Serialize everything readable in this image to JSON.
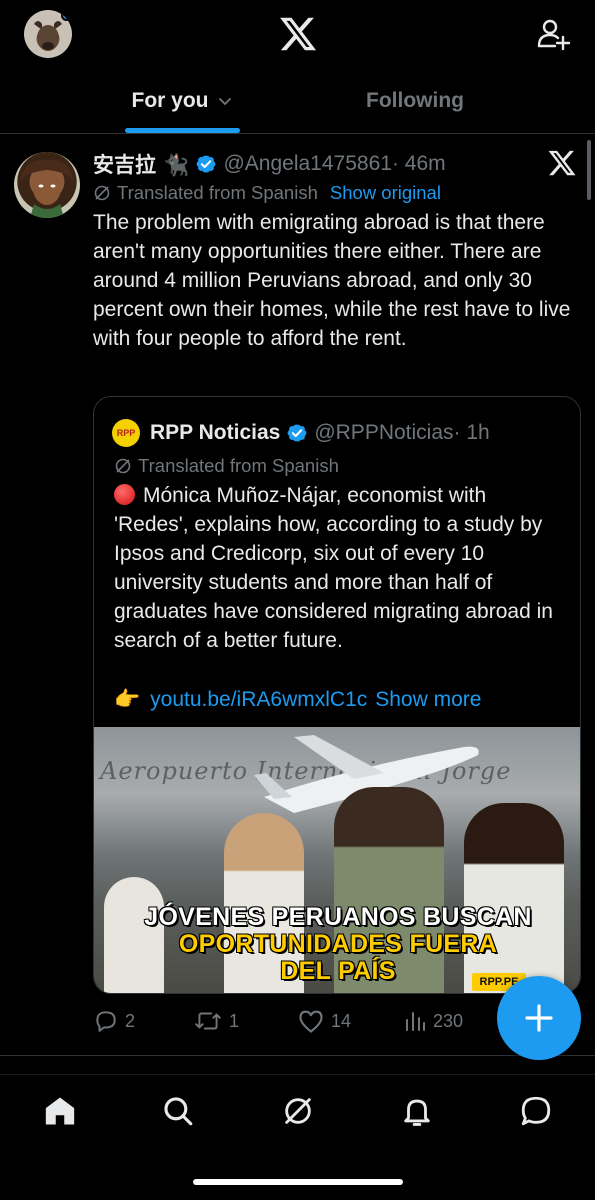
{
  "header": {
    "tabs": [
      {
        "label": "For you",
        "active": true
      },
      {
        "label": "Following",
        "active": false
      }
    ]
  },
  "post": {
    "name": "安吉拉 🐈‍⬛",
    "handle": "@Angela1475861",
    "time": "· 46m",
    "translated_label": "Translated from Spanish",
    "show_original": "Show original",
    "text": "The problem with emigrating abroad is that there aren't many opportunities there either. There are around 4 million Peruvians abroad, and only 30 percent own their homes, while the rest have to live with four people to afford the rent.",
    "quote": {
      "avatar_text": "RPP",
      "name": "RPP Noticias",
      "handle": "@RPPNoticias",
      "time": "· 1h",
      "translated_label": "Translated from Spanish",
      "text": "Mónica Muñoz-Nájar, economist with 'Redes', explains how, according to a study by Ipsos and Credicorp, six out of every 10 university students and more than half of graduates have considered migrating abroad in search of a better future.",
      "link_emoji": "👉",
      "link": "youtu.be/iRA6wmxlC1c",
      "show_more": "Show more",
      "media": {
        "sign_text": "Aeropuerto Internacional Jorge",
        "title_line1": "JÓVENES PERUANOS BUSCAN",
        "title_line2": "OPORTUNIDADES FUERA",
        "title_line3": "DEL PAÍS",
        "badge": "RPP.PE"
      }
    },
    "actions": {
      "replies": "2",
      "reposts": "1",
      "likes": "14",
      "views": "230"
    }
  },
  "colors": {
    "accent": "#1d9bf0",
    "background": "#000000",
    "muted": "#71767b",
    "text": "#e7e9ea"
  },
  "icons": [
    "x-logo-icon",
    "add-user-icon",
    "chevron-down-icon",
    "verified-badge-icon",
    "translate-icon",
    "reply-icon",
    "repost-icon",
    "like-icon",
    "views-icon",
    "compose-plus-icon",
    "home-icon",
    "search-icon",
    "grok-icon",
    "notifications-icon",
    "messages-icon"
  ]
}
